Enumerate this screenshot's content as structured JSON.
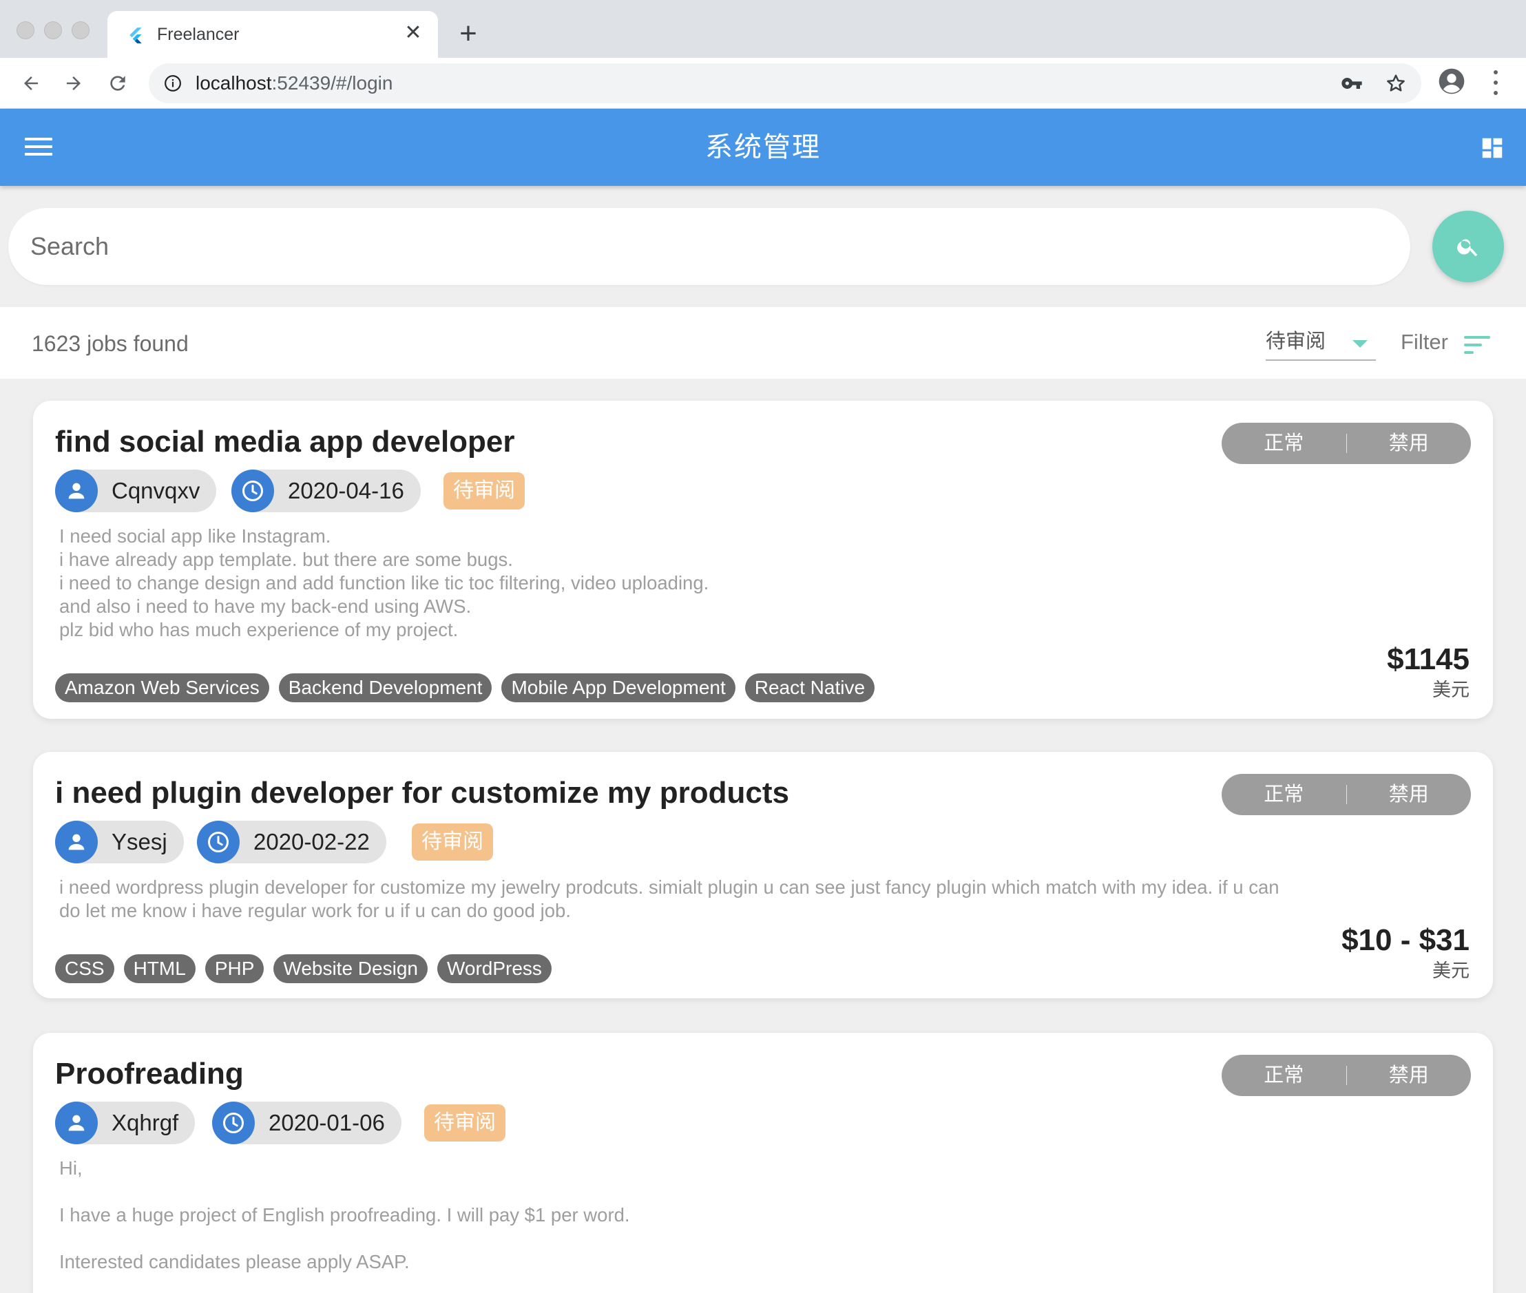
{
  "browser": {
    "tab_title": "Freelancer",
    "url_host": "localhost",
    "url_rest": ":52439/#/login"
  },
  "appbar": {
    "title": "系统管理"
  },
  "search": {
    "placeholder": "Search"
  },
  "results": {
    "count_text": "1623 jobs found",
    "status_value": "待审阅",
    "filter_label": "Filter"
  },
  "jobs": [
    {
      "title": "find social media app developer",
      "user": "Cqnvqxv",
      "date": "2020-04-16",
      "status": "待审阅",
      "toggle_on": "正常",
      "toggle_off": "禁用",
      "description": [
        "I need social app like Instagram.",
        "i have already app template. but there are some bugs.",
        "i need to change design and add function like tic toc filtering, video uploading.",
        "and also i need to have my back-end using AWS.",
        "plz bid  who has much experience of my project."
      ],
      "tags": [
        "Amazon Web Services",
        "Backend Development",
        "Mobile App Development",
        "React Native"
      ],
      "price": "$1145",
      "currency": "美元"
    },
    {
      "title": "i need plugin developer for customize my products",
      "user": "Ysesj",
      "date": "2020-02-22",
      "status": "待审阅",
      "toggle_on": "正常",
      "toggle_off": "禁用",
      "description": [
        "i need wordpress plugin developer for customize my jewelry prodcuts.  simialt plugin u can see just fancy plugin which match with my idea. if u can",
        "do let me know i have regular work for u if u can do good job."
      ],
      "tags": [
        "CSS",
        "HTML",
        "PHP",
        "Website Design",
        "WordPress"
      ],
      "price": "$10 - $31",
      "currency": "美元"
    },
    {
      "title": "Proofreading",
      "user": "Xqhrgf",
      "date": "2020-01-06",
      "status": "待审阅",
      "toggle_on": "正常",
      "toggle_off": "禁用",
      "description": [
        "Hi,",
        "I have a huge project of English proofreading. I will pay $1 per word.",
        "Interested candidates please apply ASAP."
      ]
    }
  ],
  "colors": {
    "appbar": "#4796e8",
    "accent": "#6fd3bf",
    "badge": "#f5c28b",
    "avatar": "#3b7fd5",
    "tag": "#6b6b6b",
    "toggle": "#9d9d9d"
  },
  "icons": [
    "menu-icon",
    "dashboard-icon",
    "search-icon",
    "person-icon",
    "clock-icon",
    "filter-icon",
    "key-icon",
    "star-icon",
    "profile-icon"
  ]
}
